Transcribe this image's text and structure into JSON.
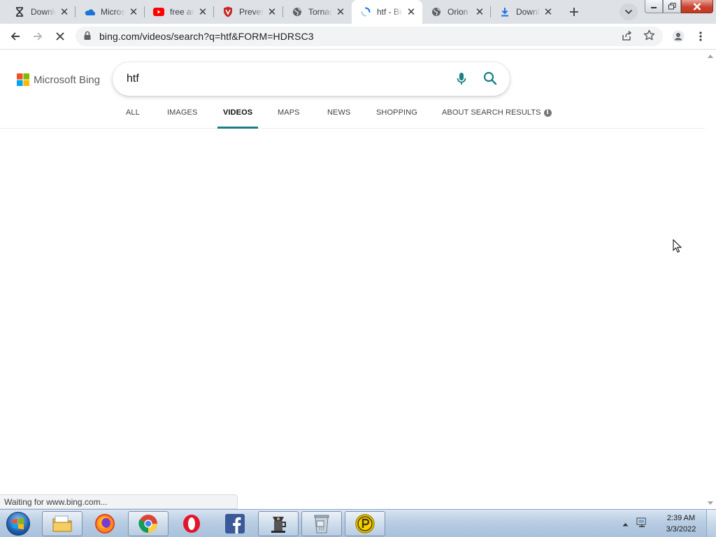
{
  "browser": {
    "tabs": [
      {
        "title": "Download",
        "icon": "hourglass-icon"
      },
      {
        "title": "Microsoft",
        "icon": "onedrive-cloud-icon"
      },
      {
        "title": "free antivirus",
        "icon": "youtube-icon"
      },
      {
        "title": "Prevent",
        "icon": "shield-icon"
      },
      {
        "title": "Tornado",
        "icon": "globe-icon"
      },
      {
        "title": "htf - Bing",
        "icon": "loading-spinner-icon",
        "active": true
      },
      {
        "title": "Orion",
        "icon": "globe-icon"
      },
      {
        "title": "Download",
        "icon": "download-icon"
      }
    ],
    "address_url": "bing.com/videos/search?q=htf&FORM=HDRSC3",
    "status_text": "Waiting for www.bing.com..."
  },
  "bing": {
    "logo_text": "Microsoft Bing",
    "search_value": "htf",
    "scopes": [
      {
        "label": "ALL"
      },
      {
        "label": "IMAGES"
      },
      {
        "label": "VIDEOS",
        "active": true
      },
      {
        "label": "MAPS"
      },
      {
        "label": "NEWS"
      },
      {
        "label": "SHOPPING"
      },
      {
        "label": "ABOUT SEARCH RESULTS"
      }
    ]
  },
  "taskbar": {
    "apps": [
      "windows-explorer-icon",
      "firefox-icon",
      "chrome-icon",
      "opera-icon",
      "facebook-icon",
      "coffee-maker-icon",
      "recycle-bin-icon",
      "p-coin-icon"
    ],
    "time": "2:39 AM",
    "date": "3/3/2022"
  },
  "colors": {
    "tabstrip_bg": "#dee1e6",
    "bing_accent": "#1a7f86",
    "taskbar_bg": "#b9cde3"
  }
}
